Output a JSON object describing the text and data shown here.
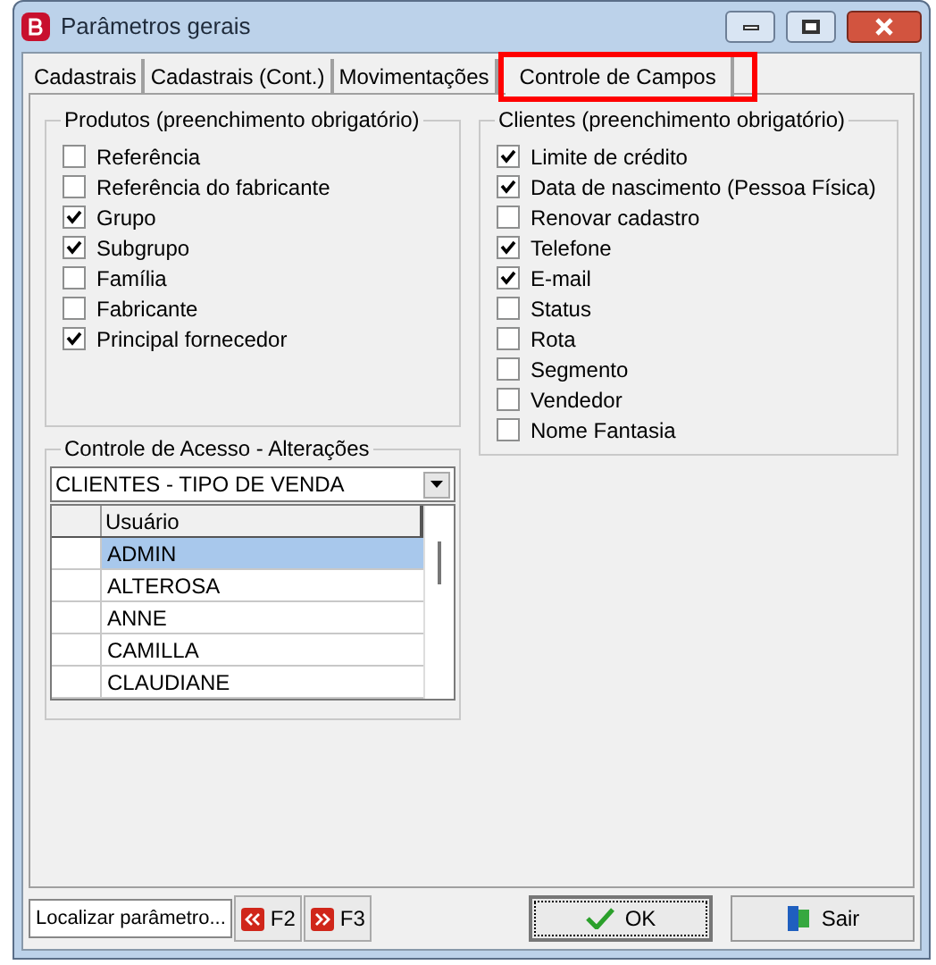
{
  "window": {
    "title": "Parâmetros gerais"
  },
  "tabs": [
    {
      "label": "Cadastrais",
      "selected": false,
      "highlighted": false
    },
    {
      "label": "Cadastrais (Cont.)",
      "selected": false,
      "highlighted": false
    },
    {
      "label": "Movimentações",
      "selected": false,
      "highlighted": false
    },
    {
      "label": "Controle de Campos",
      "selected": true,
      "highlighted": true
    }
  ],
  "produtos": {
    "title": "Produtos (preenchimento obrigatório)",
    "items": [
      {
        "label": "Referência",
        "checked": false
      },
      {
        "label": "Referência do fabricante",
        "checked": false
      },
      {
        "label": "Grupo",
        "checked": true
      },
      {
        "label": "Subgrupo",
        "checked": true
      },
      {
        "label": "Família",
        "checked": false
      },
      {
        "label": "Fabricante",
        "checked": false
      },
      {
        "label": "Principal fornecedor",
        "checked": true
      }
    ]
  },
  "clientes": {
    "title": "Clientes (preenchimento obrigatório)",
    "items": [
      {
        "label": "Limite de crédito",
        "checked": true
      },
      {
        "label": "Data de nascimento (Pessoa Física)",
        "checked": true
      },
      {
        "label": "Renovar cadastro",
        "checked": false
      },
      {
        "label": "Telefone",
        "checked": true
      },
      {
        "label": "E-mail",
        "checked": true
      },
      {
        "label": "Status",
        "checked": false
      },
      {
        "label": "Rota",
        "checked": false
      },
      {
        "label": "Segmento",
        "checked": false
      },
      {
        "label": "Vendedor",
        "checked": false
      },
      {
        "label": "Nome Fantasia",
        "checked": false
      }
    ]
  },
  "acesso": {
    "title": "Controle de Acesso - Alterações",
    "dropdown": "CLIENTES - TIPO DE VENDA",
    "column": "Usuário",
    "rows": [
      {
        "name": "ADMIN",
        "selected": true
      },
      {
        "name": "ALTEROSA",
        "selected": false
      },
      {
        "name": "ANNE",
        "selected": false
      },
      {
        "name": "CAMILLA",
        "selected": false
      },
      {
        "name": "CLAUDIANE",
        "selected": false
      }
    ]
  },
  "footer": {
    "search": "Localizar parâmetro...",
    "prev": "F2",
    "next": "F3",
    "ok": "OK",
    "exit": "Sair"
  }
}
